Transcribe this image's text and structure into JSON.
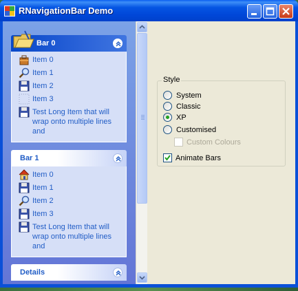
{
  "window": {
    "title": "RNavigationBar Demo",
    "icon": "app-window-icon"
  },
  "titlebar_buttons": [
    "minimize-icon",
    "maximize-icon",
    "close-icon"
  ],
  "groups": [
    {
      "title": "Bar 0",
      "active": true,
      "items": [
        {
          "label": "Item 0",
          "icon": "bag-icon"
        },
        {
          "label": "Item 1",
          "icon": "magnifier-icon"
        },
        {
          "label": "Item 2",
          "icon": "floppy-disk-icon"
        },
        {
          "label": "Item 3",
          "icon": "blank-icon"
        },
        {
          "label": "Test Long Item that will wrap onto multiple lines and",
          "icon": "floppy-disk-icon"
        }
      ]
    },
    {
      "title": "Bar 1",
      "active": false,
      "items": [
        {
          "label": "Item 0",
          "icon": "home-icon"
        },
        {
          "label": "Item 1",
          "icon": "floppy-disk-icon"
        },
        {
          "label": "Item 2",
          "icon": "magnifier-icon"
        },
        {
          "label": "Item 3",
          "icon": "floppy-disk-icon"
        },
        {
          "label": "Test Long Item that will wrap onto multiple lines and",
          "icon": "floppy-disk-icon"
        }
      ]
    },
    {
      "title": "Details",
      "active": false,
      "items": []
    }
  ],
  "style_group": {
    "legend": "Style",
    "options": [
      "System",
      "Classic",
      "XP",
      "Customised"
    ],
    "selected": "XP",
    "custom_colours": {
      "label": "Custom Colours",
      "checked": false,
      "enabled": false
    },
    "animate_bars": {
      "label": "Animate Bars",
      "checked": true
    }
  },
  "colors": {
    "accent": "#215dc6",
    "titlebar": "#0a50d8",
    "nav_bg": "#7ba2e7"
  }
}
